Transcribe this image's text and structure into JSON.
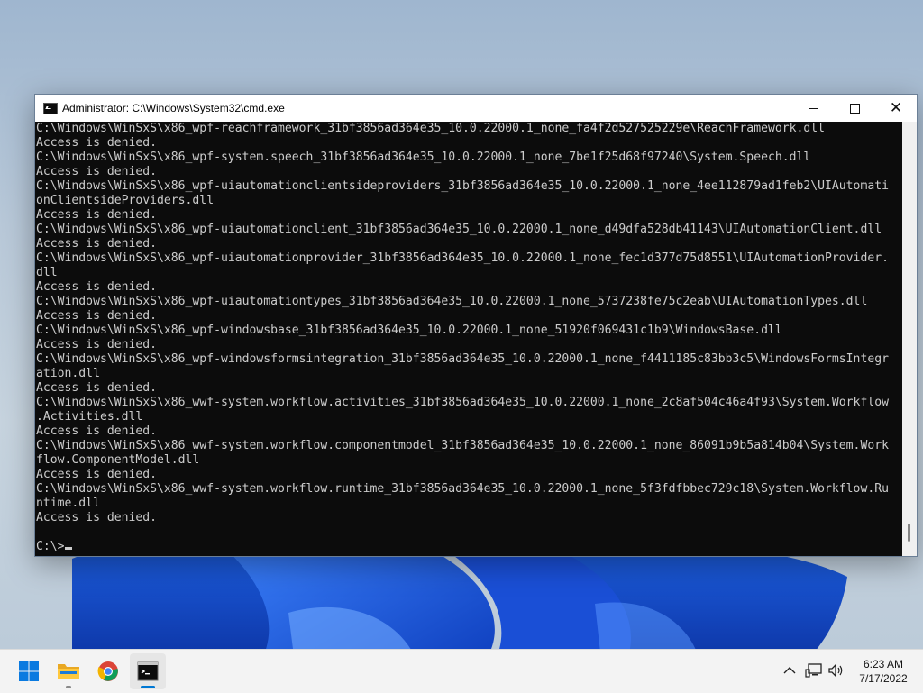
{
  "window": {
    "title": "Administrator: C:\\Windows\\System32\\cmd.exe",
    "icon": "cmd-icon"
  },
  "console": {
    "lines": [
      "C:\\Windows\\WinSxS\\x86_wpf-reachframework_31bf3856ad364e35_10.0.22000.1_none_fa4f2d527525229e\\ReachFramework.dll",
      "Access is denied.",
      "C:\\Windows\\WinSxS\\x86_wpf-system.speech_31bf3856ad364e35_10.0.22000.1_none_7be1f25d68f97240\\System.Speech.dll",
      "Access is denied.",
      "C:\\Windows\\WinSxS\\x86_wpf-uiautomationclientsideproviders_31bf3856ad364e35_10.0.22000.1_none_4ee112879ad1feb2\\UIAutomati",
      "onClientsideProviders.dll",
      "Access is denied.",
      "C:\\Windows\\WinSxS\\x86_wpf-uiautomationclient_31bf3856ad364e35_10.0.22000.1_none_d49dfa528db41143\\UIAutomationClient.dll",
      "Access is denied.",
      "C:\\Windows\\WinSxS\\x86_wpf-uiautomationprovider_31bf3856ad364e35_10.0.22000.1_none_fec1d377d75d8551\\UIAutomationProvider.",
      "dll",
      "Access is denied.",
      "C:\\Windows\\WinSxS\\x86_wpf-uiautomationtypes_31bf3856ad364e35_10.0.22000.1_none_5737238fe75c2eab\\UIAutomationTypes.dll",
      "Access is denied.",
      "C:\\Windows\\WinSxS\\x86_wpf-windowsbase_31bf3856ad364e35_10.0.22000.1_none_51920f069431c1b9\\WindowsBase.dll",
      "Access is denied.",
      "C:\\Windows\\WinSxS\\x86_wpf-windowsformsintegration_31bf3856ad364e35_10.0.22000.1_none_f4411185c83bb3c5\\WindowsFormsIntegr",
      "ation.dll",
      "Access is denied.",
      "C:\\Windows\\WinSxS\\x86_wwf-system.workflow.activities_31bf3856ad364e35_10.0.22000.1_none_2c8af504c46a4f93\\System.Workflow",
      ".Activities.dll",
      "Access is denied.",
      "C:\\Windows\\WinSxS\\x86_wwf-system.workflow.componentmodel_31bf3856ad364e35_10.0.22000.1_none_86091b9b5a814b04\\System.Work",
      "flow.ComponentModel.dll",
      "Access is denied.",
      "C:\\Windows\\WinSxS\\x86_wwf-system.workflow.runtime_31bf3856ad364e35_10.0.22000.1_none_5f3fdfbbec729c18\\System.Workflow.Ru",
      "ntime.dll",
      "Access is denied.",
      "",
      "C:\\>"
    ]
  },
  "taskbar": {
    "apps": [
      {
        "name": "Start",
        "icon": "windows-logo-icon"
      },
      {
        "name": "File Explorer",
        "icon": "folder-icon"
      },
      {
        "name": "Google Chrome",
        "icon": "chrome-icon"
      },
      {
        "name": "Command Prompt",
        "icon": "cmd-icon",
        "active": true
      }
    ],
    "tray": {
      "icons": [
        "chevron-up-icon",
        "network-icon",
        "speaker-icon"
      ]
    },
    "clock": {
      "time": "6:23 AM",
      "date": "7/17/2022"
    }
  },
  "colors": {
    "console_bg": "#0c0c0c",
    "console_fg": "#cccccc",
    "accent": "#0078d4"
  }
}
